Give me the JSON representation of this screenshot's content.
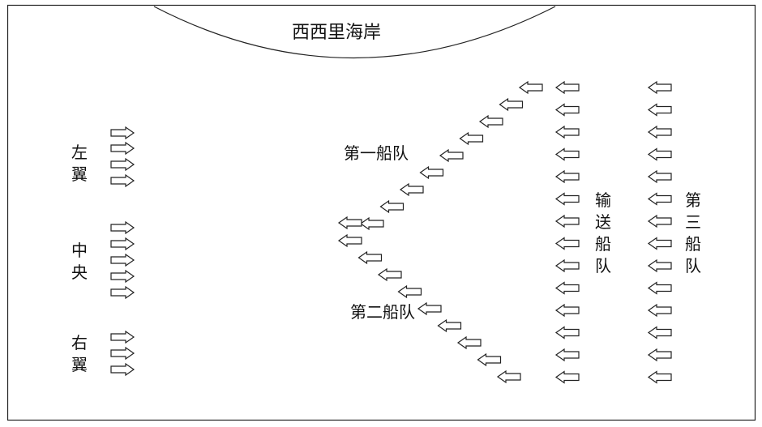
{
  "coast": {
    "label": "西西里海岸"
  },
  "fleets": {
    "first": {
      "label": "第一船队"
    },
    "second": {
      "label": "第二船队"
    },
    "transport": {
      "label": "输送船队"
    },
    "third": {
      "label": "第三船队"
    }
  },
  "defense": {
    "left_wing": {
      "label": "左翼"
    },
    "center": {
      "label": "中央"
    },
    "right_wing": {
      "label": "右翼"
    }
  },
  "colors": {
    "stroke": "#222222",
    "background": "#ffffff"
  },
  "icons": {
    "ship": "left-arrow-icon",
    "defender": "right-arrow-icon"
  }
}
